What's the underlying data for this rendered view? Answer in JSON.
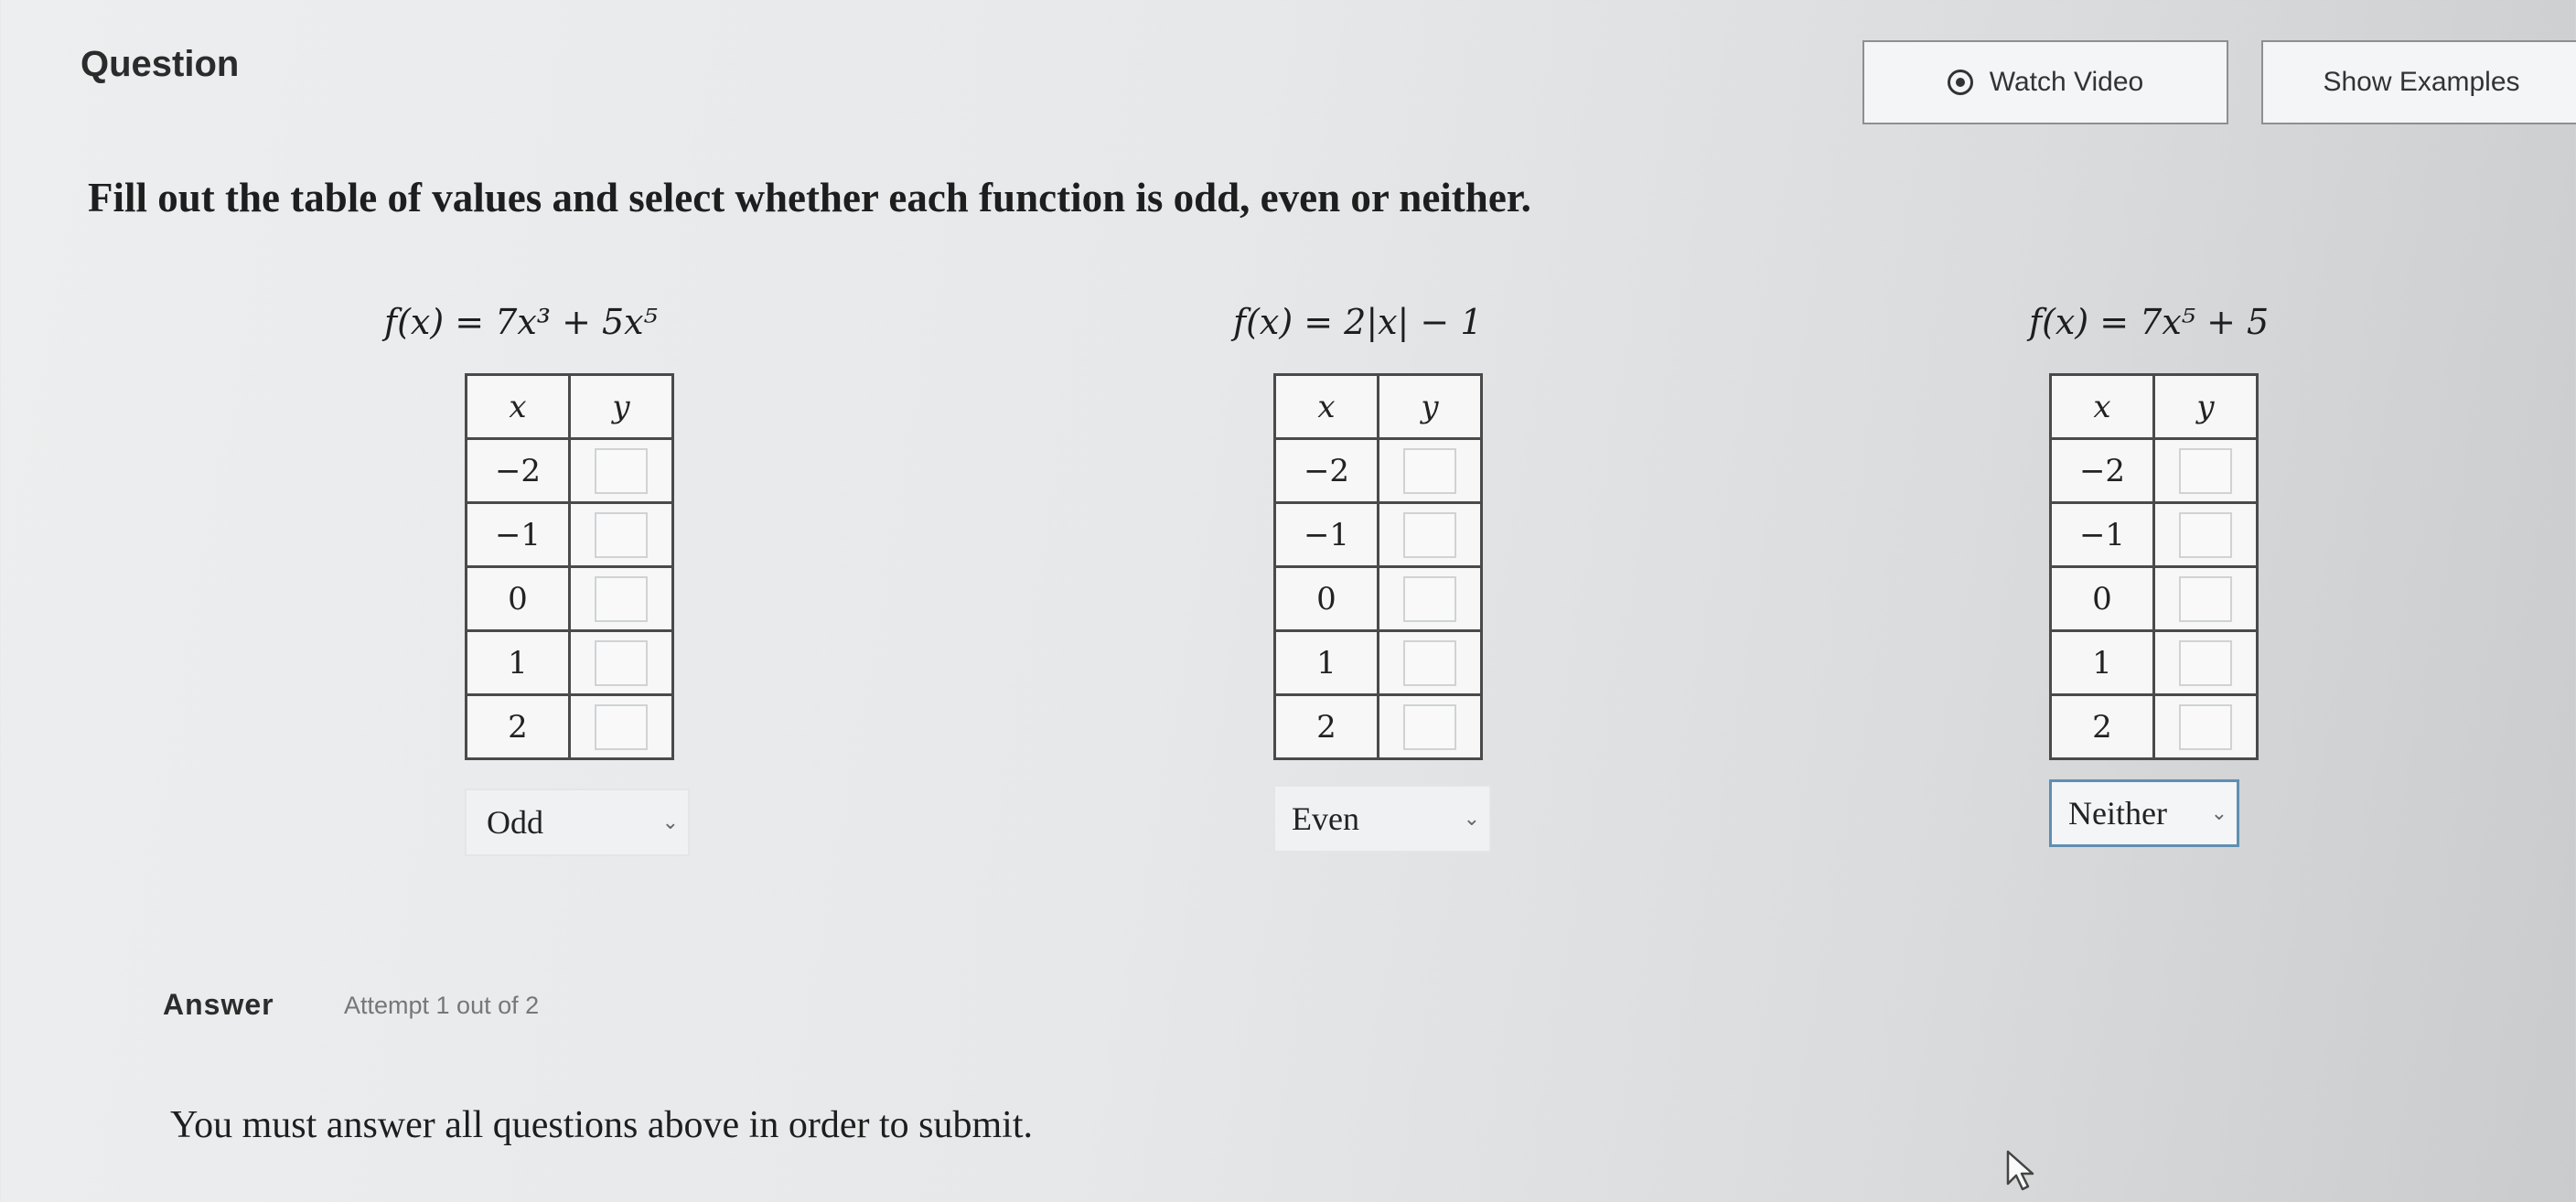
{
  "header": {
    "question_label": "Question",
    "watch_video_label": "Watch Video",
    "show_examples_label": "Show Examples"
  },
  "instructions": "Fill out the table of values and select whether each function is odd, even or neither.",
  "functions": [
    {
      "formula": "f(x) = 7x³ + 5x⁵",
      "table_headers": [
        "x",
        "y"
      ],
      "x_values": [
        "−2",
        "−1",
        "0",
        "1",
        "2"
      ],
      "selected": "Odd"
    },
    {
      "formula": "f(x) = 2|x| − 1",
      "table_headers": [
        "x",
        "y"
      ],
      "x_values": [
        "−2",
        "−1",
        "0",
        "1",
        "2"
      ],
      "selected": "Even"
    },
    {
      "formula": "f(x) = 7x⁵ + 5",
      "table_headers": [
        "x",
        "y"
      ],
      "x_values": [
        "−2",
        "−1",
        "0",
        "1",
        "2"
      ],
      "selected": "Neither"
    }
  ],
  "answer": {
    "label": "Answer",
    "attempt_text": "Attempt 1 out of 2"
  },
  "submit_message": "You must answer all questions above in order to submit.",
  "icons": {
    "watch_video": "play-circle-icon",
    "dropdown": "chevron-down-icon",
    "cursor": "mouse-pointer-icon"
  },
  "colors": {
    "focused_dropdown_border": "#5f8fb1"
  }
}
